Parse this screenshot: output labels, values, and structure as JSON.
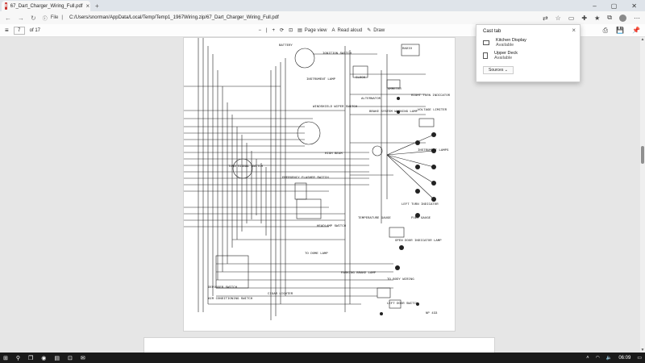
{
  "browser": {
    "tab_title": "67_Dart_Charger_Wiring_Full.pdf",
    "new_tab": "+",
    "file_label": "File",
    "url": "C:/Users/snorman/AppData/Local/Temp/Temp1_1967Wiring.zip/67_Dart_Charger_Wiring_Full.pdf"
  },
  "pdf_toolbar": {
    "page_number": "7",
    "page_total": "of 17",
    "page_view": "Page view",
    "read_aloud": "Read aloud",
    "draw": "Draw"
  },
  "cast_panel": {
    "title": "Cast tab",
    "devices": [
      {
        "name": "Kitchen Display",
        "status": "Available"
      },
      {
        "name": "Upper Deck",
        "status": "Available"
      }
    ],
    "sources_label": "Sources"
  },
  "diagram_labels": [
    {
      "id": "battery",
      "text": "BATTERY"
    },
    {
      "id": "ignition",
      "text": "IGNITION SWITCH"
    },
    {
      "id": "instrument-lamp",
      "text": "INSTRUMENT LAMP"
    },
    {
      "id": "radio",
      "text": "RADIO"
    },
    {
      "id": "clock",
      "text": "CLOCK"
    },
    {
      "id": "ammeter",
      "text": "AMMETER"
    },
    {
      "id": "alternator",
      "text": "ALTERNATOR"
    },
    {
      "id": "wiper",
      "text": "WINDSHIELD WIPER SWITCH"
    },
    {
      "id": "brake",
      "text": "BRAKE SYSTEM WARNING LAMP"
    },
    {
      "id": "right-turn",
      "text": "RIGHT TURN INDICATOR"
    },
    {
      "id": "voltage",
      "text": "VOLTAGE LIMITER"
    },
    {
      "id": "high-beam-ind",
      "text": "HIGH BEAM"
    },
    {
      "id": "instrument-lamps",
      "text": "INSTRUMENT LAMPS"
    },
    {
      "id": "turn-signal",
      "text": "TURN SIGNAL SWITCH"
    },
    {
      "id": "flasher",
      "text": "EMERGENCY FLASHER SWITCH"
    },
    {
      "id": "headlamp",
      "text": "HEADLAMP SWITCH"
    },
    {
      "id": "fuel",
      "text": "FUEL GAUGE"
    },
    {
      "id": "temp",
      "text": "TEMPERATURE GAUGE"
    },
    {
      "id": "left-turn",
      "text": "LEFT TURN INDICATOR"
    },
    {
      "id": "open-door",
      "text": "OPEN DOOR INDICATOR LAMP"
    },
    {
      "id": "dome",
      "text": "TO DOME LAMP"
    },
    {
      "id": "parking-brake",
      "text": "PARKING BRAKE LAMP"
    },
    {
      "id": "body-wiring",
      "text": "TO BODY WIRING"
    },
    {
      "id": "defogger",
      "text": "DEFOGGER SWITCH"
    },
    {
      "id": "ac",
      "text": "AIR CONDITIONING SWITCH"
    },
    {
      "id": "cigar",
      "text": "CIGAR LIGHTER"
    },
    {
      "id": "left-door",
      "text": "LEFT DOOR SWITCH"
    },
    {
      "id": "np",
      "text": "NP 433"
    }
  ],
  "taskbar": {
    "time": "06:09"
  }
}
